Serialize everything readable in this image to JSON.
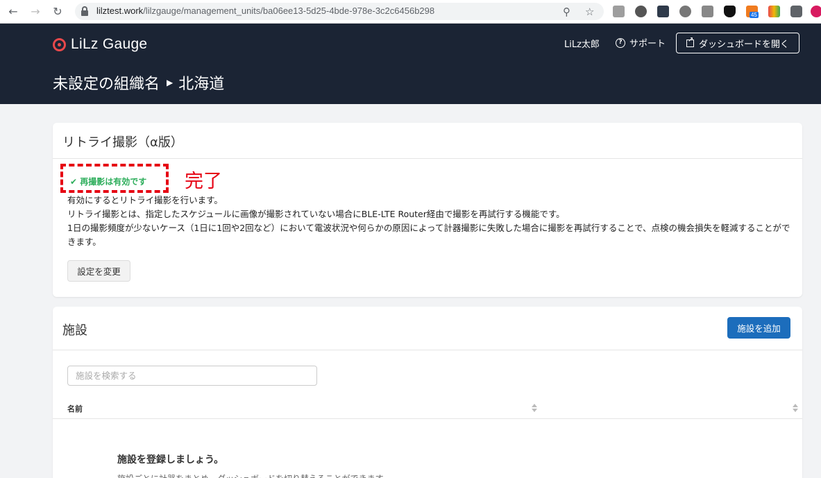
{
  "browser": {
    "url_host": "lilztest.work",
    "url_path": "/lilzgauge/management_units/ba06ee13-5d25-4bde-978e-3c2c6456b298",
    "ext_badge": "45"
  },
  "header": {
    "logo": "LiLz Gauge",
    "user": "LiLz太郎",
    "support": "サポート",
    "dashboard_button": "ダッシュボードを開く",
    "breadcrumb": [
      "未設定の組織名",
      "北海道"
    ]
  },
  "retry_card": {
    "title": "リトライ撮影（α版）",
    "status": "✔ 再撮影は有効です",
    "annotation": "完了",
    "description": [
      "有効にするとリトライ撮影を行います。",
      "リトライ撮影とは、指定したスケジュールに画像が撮影されていない場合にBLE-LTE Router経由で撮影を再試行する機能です。",
      "1日の撮影頻度が少ないケース（1日に1回や2回など）において電波状況や何らかの原因によって計器撮影に失敗した場合に撮影を再試行することで、点検の機会損失を軽減することができます。"
    ],
    "change_button": "設定を変更"
  },
  "facility_card": {
    "title": "施設",
    "add_button": "施設を追加",
    "search_placeholder": "施設を検索する",
    "column_name": "名前",
    "empty_title": "施設を登録しましょう。",
    "empty_sub": "施設ごとに計器をまとめ、ダッシュボードを切り替えることができます。"
  },
  "colors": {
    "header_bg": "#1b2434",
    "accent_blue": "#1c6dbc",
    "success_green": "#2eae5c",
    "annotation_red": "#e60012"
  }
}
